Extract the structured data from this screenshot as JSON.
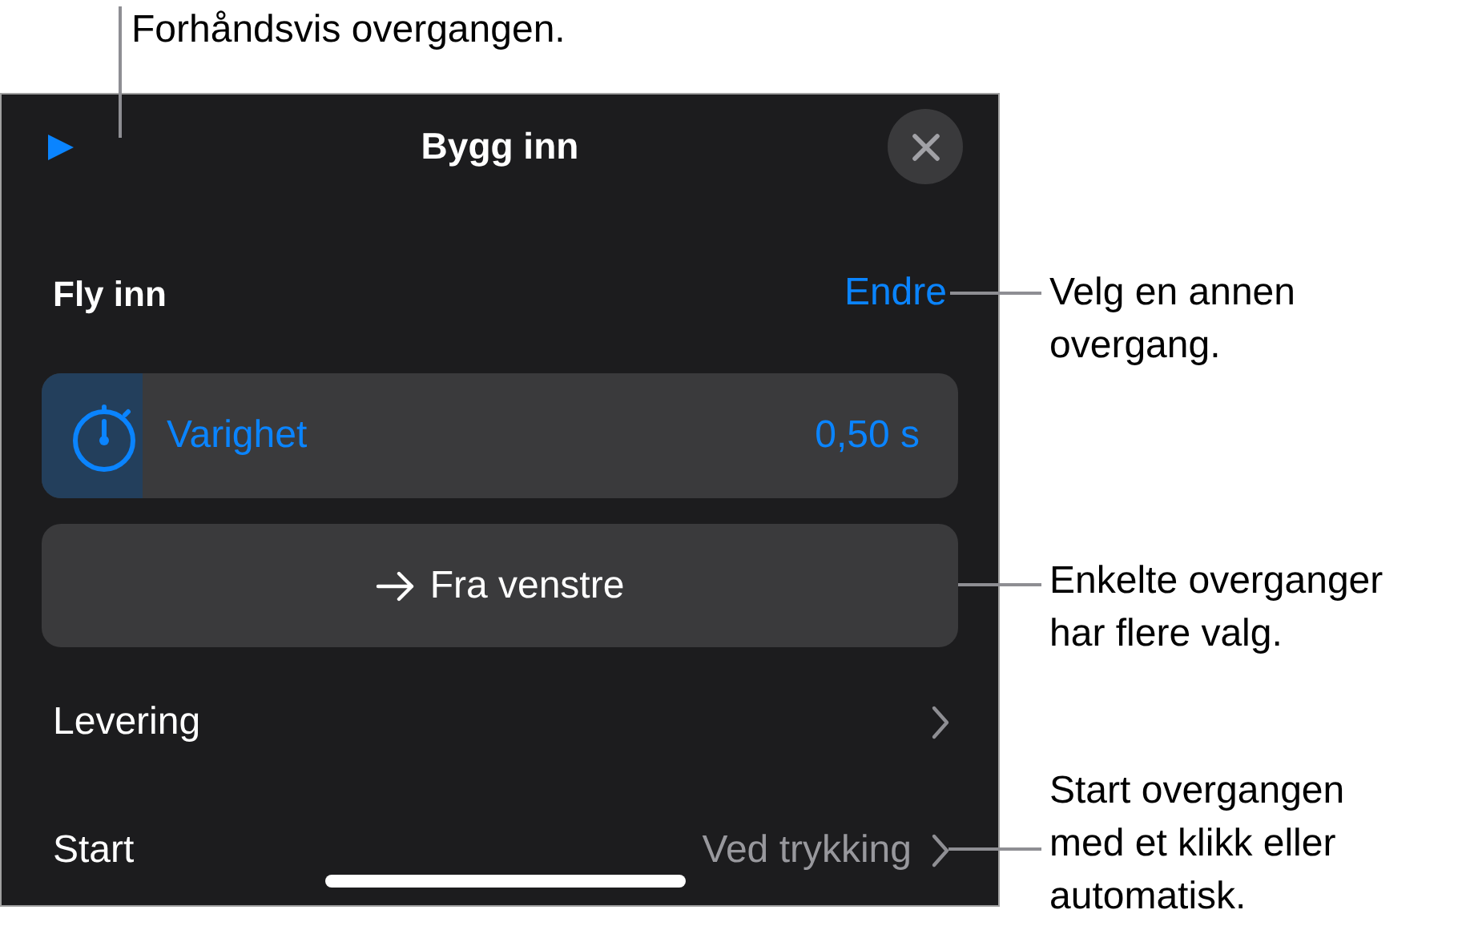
{
  "panel": {
    "title": "Bygg inn",
    "effect": {
      "name": "Fly inn",
      "change_link": "Endre"
    },
    "duration": {
      "label": "Varighet",
      "value": "0,50 s",
      "level": 0.11
    },
    "direction_button": {
      "label": "Fra venstre"
    },
    "rows": [
      {
        "label": "Levering"
      },
      {
        "label": "Start",
        "value": "Ved trykking"
      }
    ]
  },
  "callouts": [
    {
      "kind": "play",
      "lines": [
        "Forhåndsvis overgangen."
      ]
    },
    {
      "kind": "change",
      "lines": [
        "Velg en annen",
        "overgang."
      ]
    },
    {
      "kind": "direction",
      "lines": [
        "Enkelte overganger",
        "har flere valg."
      ]
    },
    {
      "kind": "start",
      "lines": [
        "Start overgangen",
        "med et klikk eller",
        "automatisk."
      ]
    }
  ]
}
